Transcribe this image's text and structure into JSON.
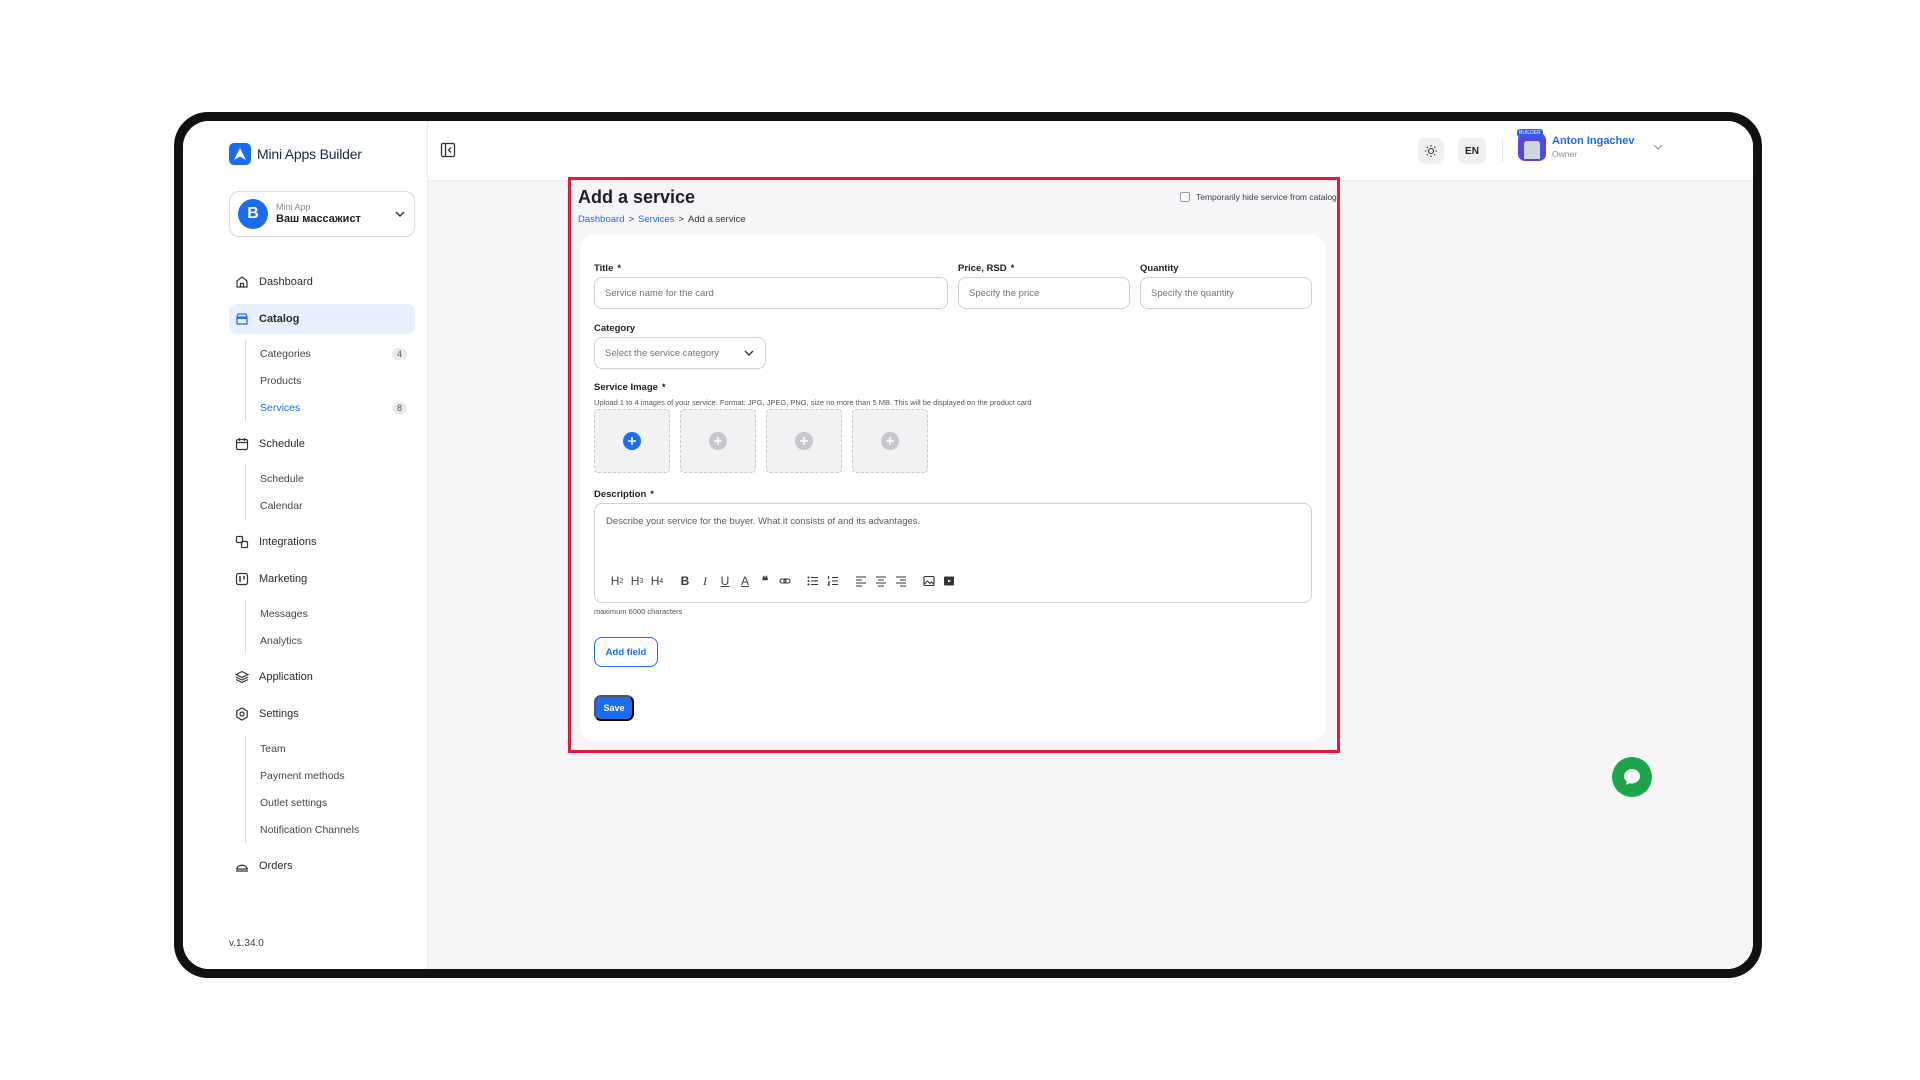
{
  "app": {
    "name": "Mini Apps Builder",
    "version": "v.1.34.0"
  },
  "app_selector": {
    "avatar_letter": "B",
    "caption": "Mini App",
    "value": "Ваш массажист"
  },
  "nav": {
    "dashboard": "Dashboard",
    "catalog": "Catalog",
    "catalog_sub": [
      {
        "label": "Categories",
        "badge": "4"
      },
      {
        "label": "Products",
        "badge": ""
      },
      {
        "label": "Services",
        "badge": "8"
      }
    ],
    "schedule": "Schedule",
    "schedule_sub": [
      "Schedule",
      "Calendar"
    ],
    "integrations": "Integrations",
    "marketing": "Marketing",
    "marketing_sub": [
      "Messages",
      "Analytics"
    ],
    "application": "Application",
    "settings": "Settings",
    "settings_sub": [
      "Team",
      "Payment methods",
      "Outlet settings",
      "Notification Channels"
    ],
    "orders": "Orders"
  },
  "topbar": {
    "lang": "EN",
    "user_name": "Anton Ingachev",
    "user_role": "Owner",
    "avatar_tag": "BUILDER"
  },
  "page": {
    "title": "Add a service",
    "breadcrumb": {
      "dashboard": "Dashboard",
      "services": "Services",
      "current": "Add a service",
      "sep": ">"
    },
    "hide_toggle": "Temporarily hide service from catalog"
  },
  "form": {
    "title_label": "Title",
    "title_placeholder": "Service name for the card",
    "price_label": "Price, RSD",
    "price_placeholder": "Specify the price",
    "quantity_label": "Quantity",
    "quantity_placeholder": "Specify the quantity",
    "required_mark": "*",
    "category_label": "Category",
    "category_placeholder": "Select the service category",
    "image_label": "Service Image",
    "image_hint": "Upload 1 to 4 images of your service. Format: JPG, JPEG, PNG, size no more than 5 MB. This will be displayed on the product card",
    "description_label": "Description",
    "description_placeholder": "Describe your service for the buyer. What it consists of and its advantages.",
    "description_hint": "maximum 6000 characters",
    "add_field": "Add field",
    "save": "Save"
  },
  "colors": {
    "accent": "#1a6cf0",
    "highlight": "#e8173b",
    "chat": "#1ea54a"
  }
}
